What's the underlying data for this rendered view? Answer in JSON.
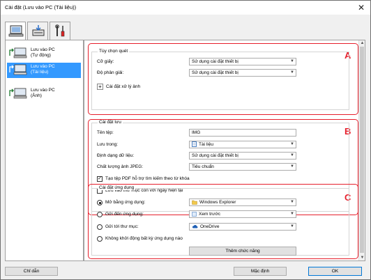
{
  "window": {
    "title": "Cài đặt (Lưu vào PC (Tài liệu))",
    "close_glyph": "✕"
  },
  "tabs": [
    {
      "icon": "computer-icon",
      "active": true
    },
    {
      "icon": "scanner-save-icon",
      "active": false
    },
    {
      "icon": "tools-icon",
      "active": false
    }
  ],
  "nav": {
    "items": [
      {
        "label1": "Lưu vào PC",
        "label2": "(Tự động)"
      },
      {
        "label1": "Lưu vào PC",
        "label2": "(Tài liệu)"
      },
      {
        "label1": "Lưu vào PC",
        "label2": "(Ảnh)"
      }
    ]
  },
  "annotations": {
    "a": "A",
    "b": "B",
    "c": "C"
  },
  "scan_options": {
    "title": "Tùy chọn quét",
    "paper_size_label": "Cỡ giấy:",
    "paper_size_value": "Sử dụng cài đặt thiết bị",
    "resolution_label": "Độ phân giải:",
    "resolution_value": "Sử dụng cài đặt thiết bị",
    "image_processing_label": "Cài đặt xử lý ảnh",
    "plus_glyph": "+"
  },
  "save_settings": {
    "title": "Cài đặt lưu",
    "filename_label": "Tên tệp:",
    "filename_value": "IMG",
    "save_in_label": "Lưu trong:",
    "save_in_value": "Tài liệu",
    "format_label": "Định dạng dữ liệu:",
    "format_value": "Sử dụng cài đặt thiết bị",
    "jpeg_quality_label": "Chất lượng ảnh JPEG:",
    "jpeg_quality_value": "Tiêu chuẩn",
    "pdf_keyword_label": "Tạo tệp PDF hỗ trợ tìm kiếm theo từ khóa",
    "pdf_keyword_checked": true,
    "subfolder_label": "Lưu vào thư mục con với ngày hiện tại",
    "subfolder_checked": false,
    "check_glyph": "✓"
  },
  "app_settings": {
    "title": "Cài đặt ứng dụng",
    "open_with_label": "Mở bằng ứng dụng:",
    "open_with_value": "Windows Explorer",
    "send_to_app_label": "Gửi đến ứng dụng:",
    "send_to_app_value": "Xem trước",
    "send_to_folder_label": "Gửi tới thư mục:",
    "send_to_folder_value": "OneDrive",
    "no_app_label": "Không khởi động bất kỳ ứng dụng nào",
    "add_function_label": "Thêm chức năng",
    "selected_option": "open_with"
  },
  "footer": {
    "instructions_label": "Chỉ dẫn",
    "defaults_label": "Mặc định",
    "ok_label": "OK"
  },
  "colors": {
    "accent_red": "#e61e2b",
    "selection_blue": "#3399ff"
  }
}
